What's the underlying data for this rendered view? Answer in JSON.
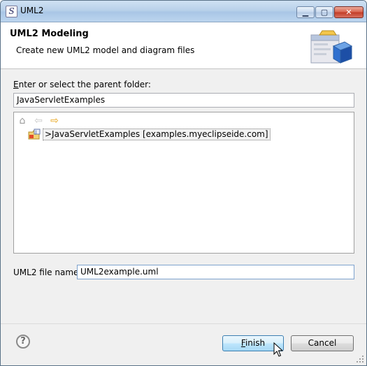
{
  "window": {
    "title": "UML2",
    "app_icon_glyph": "S",
    "icon": "eclipse-app-icon",
    "controls": {
      "minimize": "▁",
      "maximize": "▢",
      "close": "✕"
    }
  },
  "banner": {
    "title": "UML2 Modeling",
    "description": "Create new UML2 model and diagram files",
    "art_icon": "uml-model-wizard-banner-icon"
  },
  "parent_folder": {
    "label_accel": "E",
    "label_rest": "nter or select the parent folder:",
    "value": "JavaServletExamples"
  },
  "tree": {
    "toolbar_icons": [
      "home-icon",
      "back-arrow-icon",
      "forward-arrow-icon"
    ],
    "items": [
      {
        "label": ">JavaServletExamples   [examples.myeclipseide.com]",
        "icon": "java-project-icon"
      }
    ]
  },
  "file_name": {
    "label": "UML2 file name:",
    "value": "UML2example.uml"
  },
  "buttons": {
    "finish_accel": "F",
    "finish_rest": "inish",
    "cancel": "Cancel"
  },
  "colors": {
    "titlebar": "#b9d1ea",
    "finish_highlight": "#bee6fd",
    "dialog_bg": "#f0f0f0"
  }
}
